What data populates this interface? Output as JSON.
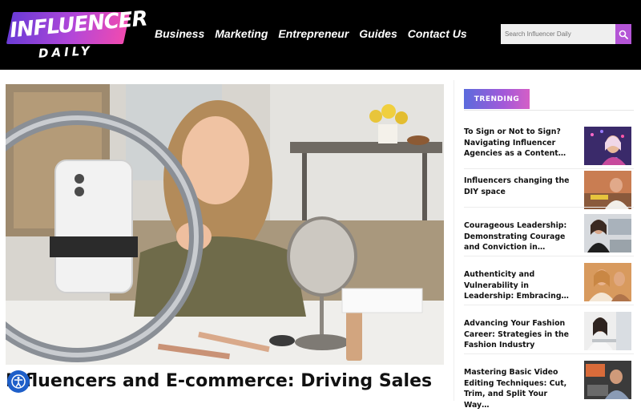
{
  "brand": {
    "logo_main": "INFLUENCER",
    "logo_sub": "DAILY",
    "accent": "#b455d6"
  },
  "nav": {
    "items": [
      "Business",
      "Marketing",
      "Entrepreneur",
      "Guides",
      "Contact Us"
    ]
  },
  "search": {
    "placeholder": "Search Influencer Daily"
  },
  "main": {
    "article_title": "Influencers and E-commerce: Driving Sales"
  },
  "sidebar": {
    "badge": "TRENDING",
    "items": [
      {
        "title": "To Sign or Not to Sign? Navigating Influencer Agencies as a Content…"
      },
      {
        "title": "Influencers changing the DIY space"
      },
      {
        "title": "Courageous Leadership: Demonstrating Courage and Conviction in…"
      },
      {
        "title": "Authenticity and Vulnerability in Leadership: Embracing…"
      },
      {
        "title": "Advancing Your Fashion Career: Strategies in the Fashion Industry"
      },
      {
        "title": "Mastering Basic Video Editing Techniques: Cut, Trim, and Split Your Way…"
      }
    ]
  }
}
